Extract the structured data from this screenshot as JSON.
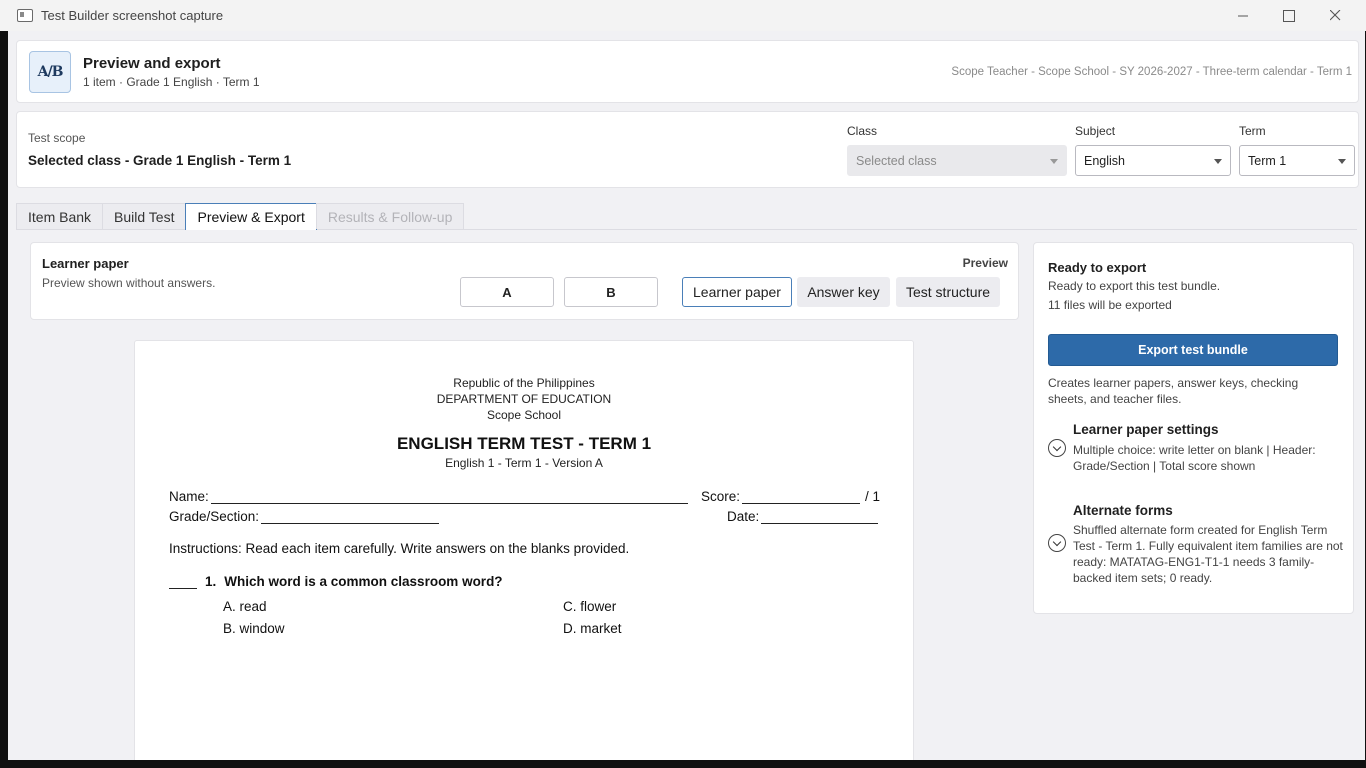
{
  "window": {
    "title": "Test Builder screenshot capture"
  },
  "header": {
    "logo_text": "A/B",
    "title": "Preview and export",
    "subtitle": "1 item · Grade 1 English · Term 1",
    "context": "Scope Teacher - Scope School - SY 2026-2027 - Three-term calendar - Term 1"
  },
  "scope": {
    "label": "Test scope",
    "value": "Selected class - Grade 1 English - Term 1",
    "class_label": "Class",
    "class_value": "Selected class",
    "subject_label": "Subject",
    "subject_value": "English",
    "term_label": "Term",
    "term_value": "Term 1"
  },
  "tabs": [
    {
      "label": "Item Bank",
      "state": "normal"
    },
    {
      "label": "Build Test",
      "state": "normal"
    },
    {
      "label": "Preview & Export",
      "state": "selected"
    },
    {
      "label": "Results & Follow-up",
      "state": "disabled"
    }
  ],
  "preview": {
    "title": "Learner paper",
    "subtitle": "Preview shown without answers.",
    "right_label": "Preview",
    "form_a": "A",
    "form_b": "B",
    "modes": [
      "Learner paper",
      "Answer key",
      "Test structure"
    ],
    "selected_mode": "Learner paper"
  },
  "paper": {
    "line1": "Republic of the Philippines",
    "line2": "DEPARTMENT OF EDUCATION",
    "line3": "Scope School",
    "title": "ENGLISH TERM TEST - TERM 1",
    "version": "English 1 - Term 1 - Version A",
    "name_label": "Name:",
    "score_label": "Score:",
    "score_total": "/ 1",
    "grade_label": "Grade/Section:",
    "date_label": "Date:",
    "instructions": "Instructions: Read each item carefully. Write answers on the blanks provided.",
    "question_number": "1.",
    "question_text": "Which word is a common classroom word?",
    "choice_a": "A. read",
    "choice_b": "B. window",
    "choice_c": "C. flower",
    "choice_d": "D. market"
  },
  "export": {
    "title": "Ready to export",
    "line1": "Ready to export this test bundle.",
    "line2": "11 files will be exported",
    "button": "Export test bundle",
    "description": "Creates learner papers, answer keys, checking sheets, and teacher files.",
    "settings_title": "Learner paper settings",
    "settings_body": "Multiple choice: write letter on blank | Header: Grade/Section | Total score shown",
    "alt_title": "Alternate forms",
    "alt_body": "Shuffled alternate form created for English Term Test - Term 1. Fully equivalent item families are not ready: MATATAG-ENG1-T1-1 needs 3 family-backed item sets; 0 ready."
  }
}
